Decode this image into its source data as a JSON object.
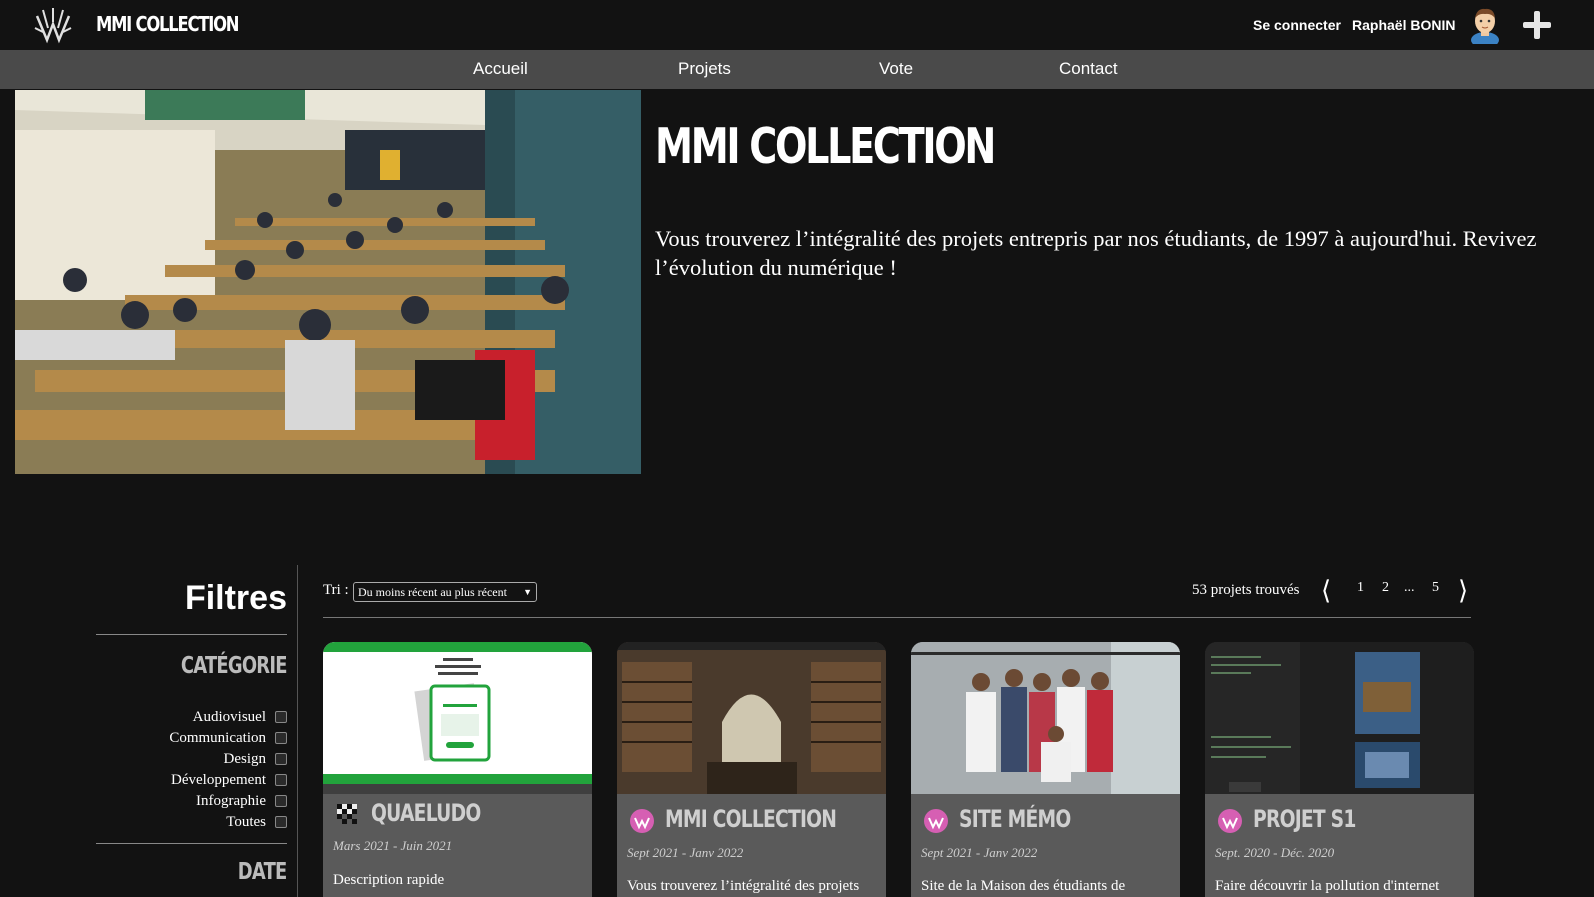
{
  "header": {
    "brand": "MMI COLLECTION",
    "login": "Se connecter",
    "user_name": "Raphaël BONIN"
  },
  "nav": {
    "items": [
      "Accueil",
      "Projets",
      "Vote",
      "Contact"
    ]
  },
  "hero": {
    "title": "MMI COLLECTION",
    "text": "Vous trouverez l’intégralité des projets entrepris par nos étudiants, de 1997 à aujourd'hui. Revivez l’évolution du numérique !"
  },
  "filters": {
    "title": "Filtres",
    "category_title": "CATÉGORIE",
    "categories": [
      "Audiovisuel",
      "Communication",
      "Design",
      "Développement",
      "Infographie",
      "Toutes"
    ],
    "date_title": "DATE"
  },
  "toolbar": {
    "sort_label": "Tri :",
    "sort_value": "Du moins récent au plus récent",
    "count": "53 projets trouvés",
    "pages": [
      "1",
      "2",
      "...",
      "5"
    ]
  },
  "cards": [
    {
      "title": "QUAELUDO",
      "date": "Mars 2021 - Juin 2021",
      "desc": "Description rapide"
    },
    {
      "title": "MMI COLLECTION",
      "date": "Sept 2021 - Janv 2022",
      "desc": "Vous trouverez l’intégralité des projets"
    },
    {
      "title": "SITE MÉMO",
      "date": "Sept 2021 - Janv 2022",
      "desc": "Site de la Maison des étudiants de"
    },
    {
      "title": "PROJET S1",
      "date": "Sept. 2020 - Déc. 2020",
      "desc": "Faire découvrir la pollution d'internet"
    }
  ],
  "colors": {
    "background": "#121212",
    "nav_bar": "#4a4a4a",
    "card": "#5a5a5a",
    "brand_pink": "#d65fb3",
    "quaeludo_green": "#22a33c"
  }
}
